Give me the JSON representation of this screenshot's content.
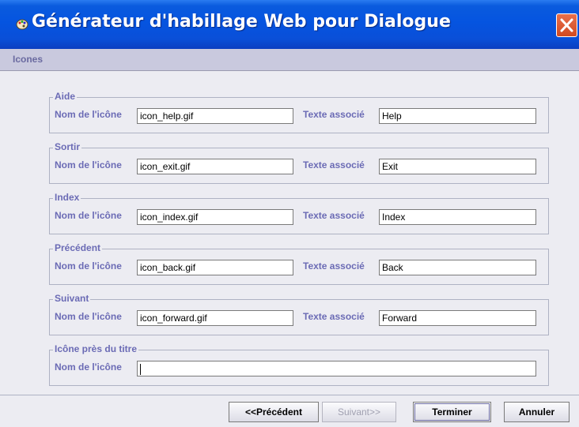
{
  "window": {
    "title": "Générateur d'habillage Web pour Dialogue",
    "app_icon": "paint-palette-icon",
    "close_icon": "close-icon",
    "accent_color": "#0a5bde",
    "close_color": "#d9552c"
  },
  "section": {
    "label": "Icones"
  },
  "groups": [
    {
      "title": "Aide",
      "name_label": "Nom de l'icône",
      "name_value": "icon_help.gif",
      "text_label": "Texte associé",
      "text_value": "Help"
    },
    {
      "title": "Sortir",
      "name_label": "Nom de l'icône",
      "name_value": "icon_exit.gif",
      "text_label": "Texte associé",
      "text_value": "Exit"
    },
    {
      "title": "Index",
      "name_label": "Nom de l'icône",
      "name_value": "icon_index.gif",
      "text_label": "Texte associé",
      "text_value": "Index"
    },
    {
      "title": "Précédent",
      "name_label": "Nom de l'icône",
      "name_value": "icon_back.gif",
      "text_label": "Texte associé",
      "text_value": "Back"
    },
    {
      "title": "Suivant",
      "name_label": "Nom de l'icône",
      "name_value": "icon_forward.gif",
      "text_label": "Texte associé",
      "text_value": "Forward"
    },
    {
      "title": "Icône près du titre",
      "name_label": "Nom de l'icône",
      "name_value": ""
    }
  ],
  "buttons": {
    "previous": "<<Précédent",
    "next": "Suivant>>",
    "finish": "Terminer",
    "cancel": "Annuler"
  }
}
